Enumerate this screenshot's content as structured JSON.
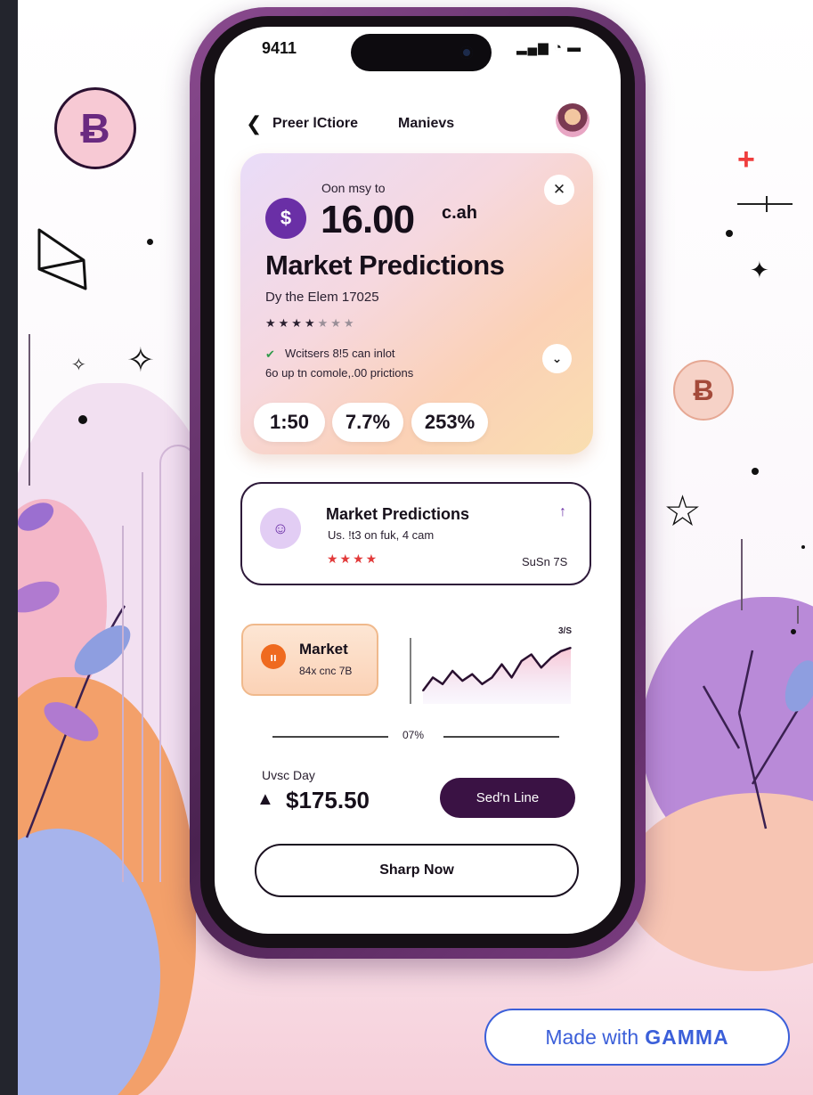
{
  "colors": {
    "accent_purple": "#6a2fa6",
    "dark_purple": "#3a1244",
    "gamma_blue": "#3b5fd9",
    "orange": "#ef6a1f"
  },
  "status_bar": {
    "time": "9411",
    "icons": "▂▄▆ ◔ ▬"
  },
  "nav": {
    "back_icon": "❮",
    "title_left": "Preer lCtiore",
    "title_right": "Manievs",
    "avatar_icon": "avatar"
  },
  "hero": {
    "small_text": "Oon msy to",
    "dollar_icon": "$",
    "amount": "16.00",
    "unit": "c.ah",
    "title": "Market Predictions",
    "subtitle": "Dy the Elem 17025",
    "rating_on": "★★★★",
    "rating_off": "★★★",
    "shield_icon": "✔",
    "line1": "Wcitsers 8!5 can inlot",
    "line2": "6o up tn comole,.00 prictions",
    "close_icon": "✕",
    "chevron_icon": "⌄",
    "stats": [
      "1:50",
      "7.7%",
      "253%"
    ]
  },
  "card2": {
    "icon": "person-icon",
    "title": "Market Predictions",
    "subtitle": "Us. !t3 on fuk, 4 cam",
    "stars": "★★★★",
    "arrow": "↑",
    "value": "SuSn 7S"
  },
  "card3": {
    "icon": "ıı",
    "title": "Market",
    "subtitle": "84x cnc 7B"
  },
  "chart_data": {
    "type": "line",
    "title": "",
    "corner_label": "3/S",
    "x": [
      0,
      1,
      2,
      3,
      4,
      5,
      6,
      7,
      8,
      9,
      10,
      11,
      12,
      13,
      14,
      15
    ],
    "values": [
      2,
      4,
      3,
      5,
      3.5,
      4.5,
      3,
      4,
      6,
      4,
      6.5,
      7.5,
      5.5,
      7,
      8,
      8.5
    ],
    "ylim": [
      0,
      10
    ],
    "grid": false
  },
  "divider_label": "07%",
  "footer": {
    "label": "Uvsc Day",
    "up_icon": "▲",
    "price": "$175.50",
    "cta_dark": "Sed'n Line",
    "cta_outline": "Sharp Now"
  },
  "gamma": {
    "prefix": "Made with",
    "brand": "GAMMA"
  },
  "decor": {
    "bitcoin_symbol": "Ƀ",
    "plus": "+",
    "star_outline": "☆",
    "sparkle": "✦",
    "sparkle_small": "✧"
  }
}
